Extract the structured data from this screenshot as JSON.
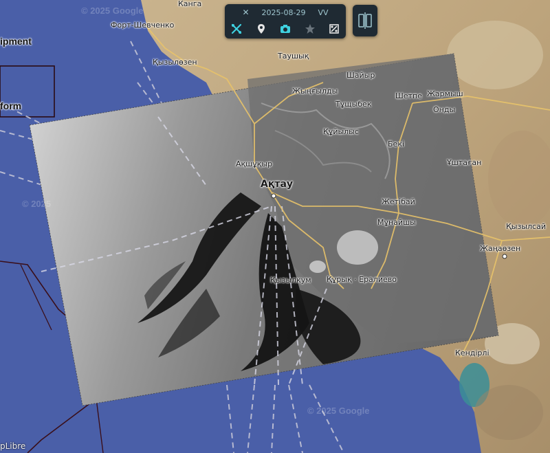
{
  "toolbar": {
    "date": "2025-08-29",
    "polarization": "VV",
    "icons": [
      "wrench-icon",
      "tools-icon",
      "place-pin-icon",
      "camera-icon",
      "star-icon",
      "crop-icon"
    ]
  },
  "split_button": {
    "icon": "split-view-icon"
  },
  "layer_labels": {
    "equipment": "ipment",
    "platform": "form"
  },
  "places": {
    "kanga": "Канга",
    "fort_shevchenko": "Форт-Шевченко",
    "kyzylozen": "Қызылөзен",
    "taushyk": "Таушық",
    "shaiyr": "Шайыр",
    "zhyngyldy": "Жыңғылды",
    "shetpe": "Шетпе",
    "zharmysh": "Жармыш",
    "ondy": "Онды",
    "tushchybek": "Тұщыбек",
    "kuiylys": "Құйылыс",
    "beki": "Бекі",
    "ushtagan": "Ұштаған",
    "akshukyr": "Ақшұқыр",
    "aktau": "Ақтау",
    "zhetibai": "Жетібай",
    "kyzylsai": "Қызылсай",
    "munaishy": "Мұнайшы",
    "zhanaozen": "Жаңаөзен",
    "kyzylkum": "Қызылкум",
    "kuryk": "Құрық · Ералиево",
    "kendirli": "Кендірлі"
  },
  "watermarks": [
    "© 2025 Google",
    "© 2025",
    "© 2025 Google",
    "© 2025 Google"
  ],
  "attribution": "pLibre"
}
